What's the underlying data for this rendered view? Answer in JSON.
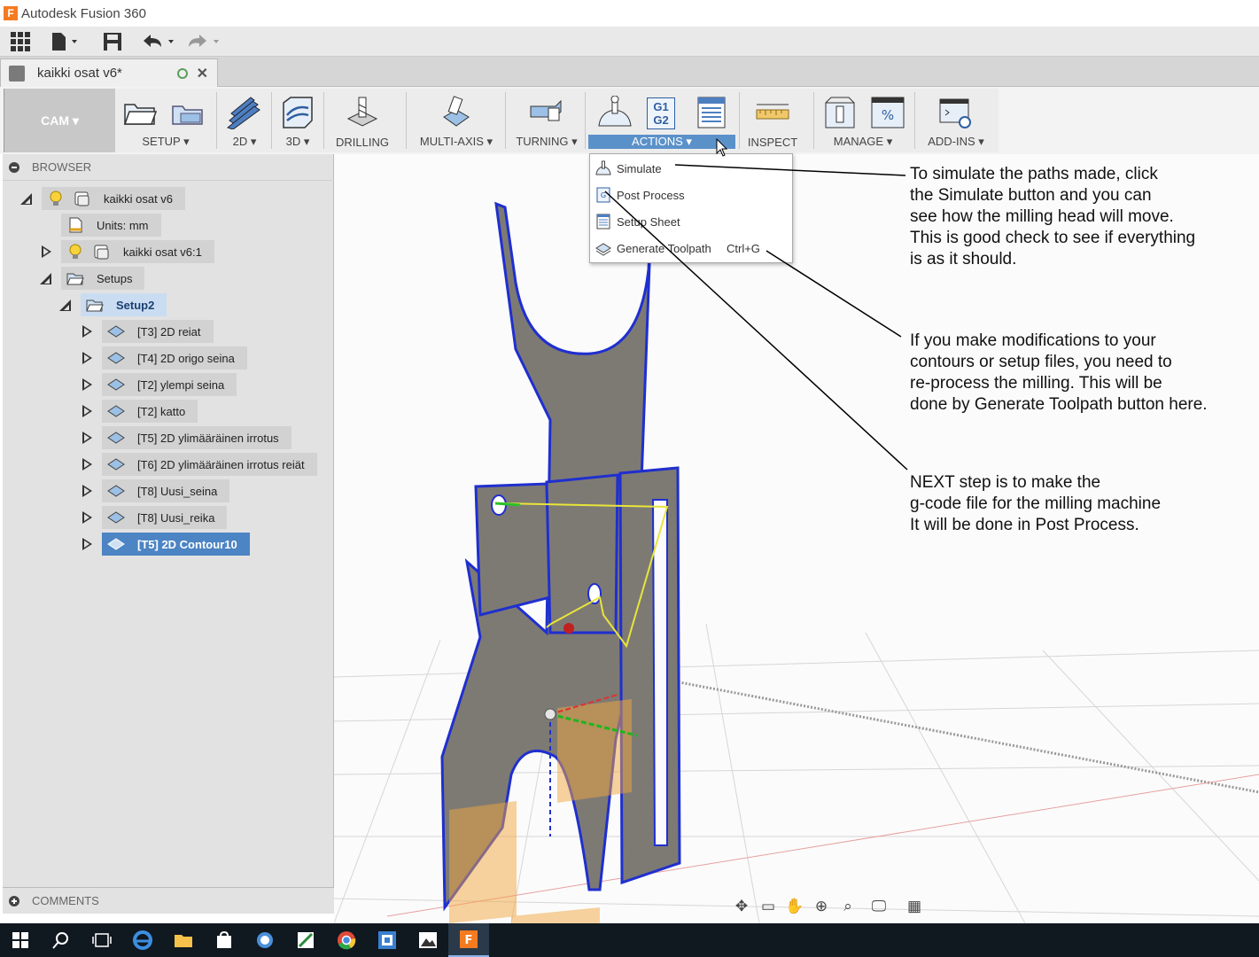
{
  "window": {
    "title": "Autodesk Fusion 360",
    "app_icon_letter": "F"
  },
  "document_tab": {
    "name": "kaikki osat v6*"
  },
  "ribbon": {
    "workspace": "CAM ▾",
    "groups": [
      {
        "label": "SETUP ▾"
      },
      {
        "label": "2D ▾"
      },
      {
        "label": "3D ▾"
      },
      {
        "label": "DRILLING"
      },
      {
        "label": "MULTI-AXIS ▾"
      },
      {
        "label": "TURNING ▾"
      },
      {
        "label": "ACTIONS ▾"
      },
      {
        "label": "INSPECT"
      },
      {
        "label": "MANAGE ▾"
      },
      {
        "label": "ADD-INS ▾"
      }
    ],
    "g1g2_icon_text": "G1\nG2"
  },
  "actions_menu": {
    "items": [
      {
        "label": "Simulate",
        "icon": "simulate-icon"
      },
      {
        "label": "Post Process",
        "icon": "post-process-icon"
      },
      {
        "label": "Setup Sheet",
        "icon": "setup-sheet-icon"
      },
      {
        "label": "Generate Toolpath",
        "icon": "generate-toolpath-icon",
        "shortcut": "Ctrl+G"
      }
    ]
  },
  "browser": {
    "title": "BROWSER",
    "nodes": [
      {
        "label": "kaikki osat v6"
      },
      {
        "label": "Units: mm"
      },
      {
        "label": "kaikki osat v6:1"
      },
      {
        "label": "Setups"
      },
      {
        "label": "Setup2"
      },
      {
        "label": "[T3] 2D reiat"
      },
      {
        "label": "[T4] 2D origo seina"
      },
      {
        "label": "[T2] ylempi seina"
      },
      {
        "label": "[T2] katto"
      },
      {
        "label": "[T5] 2D ylimääräinen irrotus"
      },
      {
        "label": "[T6] 2D ylimääräinen irrotus reiät"
      },
      {
        "label": "[T8] Uusi_seina"
      },
      {
        "label": "[T8] Uusi_reika"
      },
      {
        "label": "[T5] 2D Contour10"
      }
    ]
  },
  "comments": {
    "title": "COMMENTS"
  },
  "annotations": {
    "simulate": [
      "To simulate the paths made, click",
      "the Simulate button and you can",
      "see how the milling head will move.",
      "This is good check to see if everything",
      "is as it should."
    ],
    "generate": [
      "If you make modifications to your",
      "contours or setup files, you need to",
      "re-process the milling. This will be",
      "done by Generate Toolpath button here."
    ],
    "post": [
      "NEXT step is to make the",
      "g-code file for the milling machine",
      "It will be done in Post Process."
    ]
  },
  "colors": {
    "accent": "#5b91c9",
    "selection": "#4c84c4",
    "part": "#7d7a74",
    "edge": "#1f2fcf"
  }
}
